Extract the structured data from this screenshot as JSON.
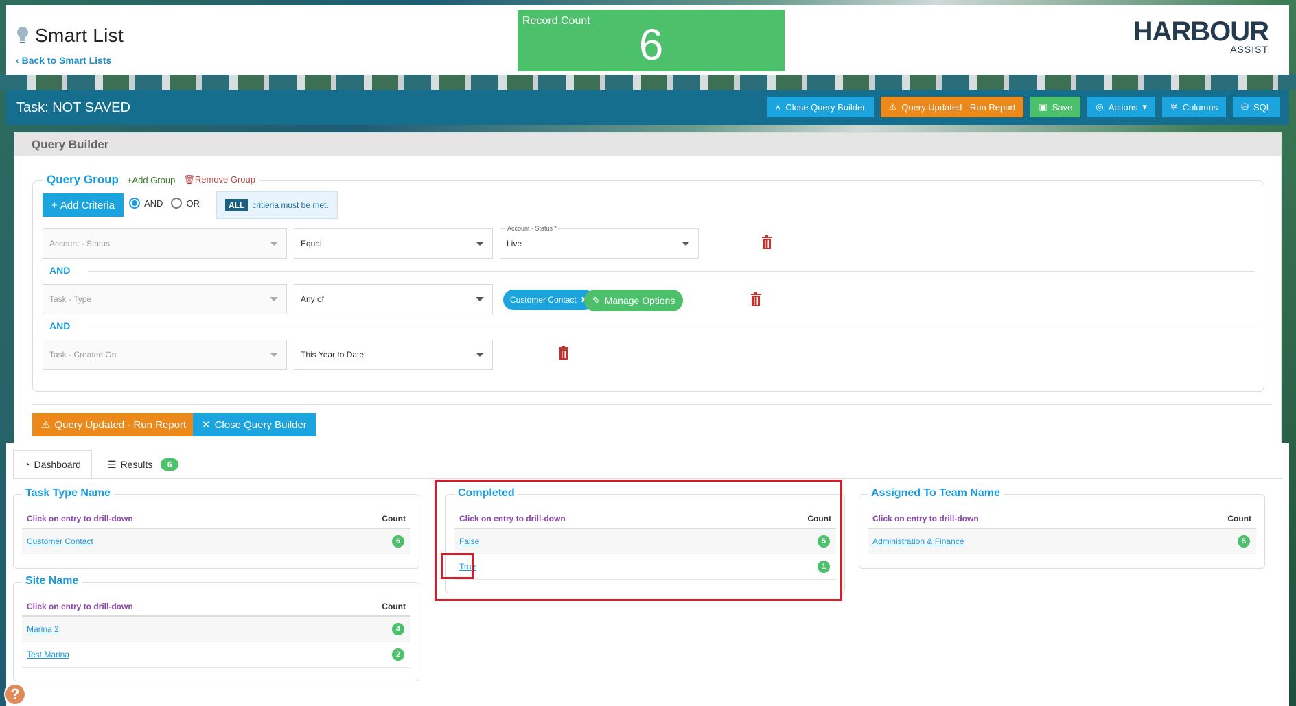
{
  "header": {
    "title": "Smart List",
    "back_link": "Back to Smart Lists",
    "record_count_label": "Record Count",
    "record_count_value": "6",
    "logo_main": "HARBOUR",
    "logo_sub": "ASSIST"
  },
  "taskbar": {
    "title": "Task: NOT SAVED",
    "buttons": {
      "close_query_builder": "Close Query Builder",
      "run_report": "Query Updated - Run Report",
      "save": "Save",
      "actions": "Actions",
      "columns": "Columns",
      "sql": "SQL"
    }
  },
  "query_builder": {
    "heading": "Query Builder",
    "group_title": "Query Group",
    "add_group": "Add Group",
    "remove_group": "Remove Group",
    "add_criteria": "Add Criteria",
    "logic_and": "AND",
    "logic_or": "OR",
    "selected_logic": "AND",
    "all_pill": "ALL",
    "all_text": "critieria must be met.",
    "connector": "AND",
    "criteria": [
      {
        "field": "Account - Status",
        "operator": "Equal",
        "value_label": "Account - Status *",
        "value": "Live"
      },
      {
        "field": "Task - Type",
        "operator": "Any of",
        "chip": "Customer Contact",
        "manage": "Manage Options"
      },
      {
        "field": "Task - Created On",
        "operator": "This Year to Date"
      }
    ],
    "bottom_run_report": "Query Updated - Run Report",
    "bottom_close": "Close Query Builder"
  },
  "tabs": {
    "dashboard": "Dashboard",
    "results": "Results",
    "results_count": "6"
  },
  "widgets": {
    "drill_label": "Click on entry to drill-down",
    "count_label": "Count",
    "task_type": {
      "title": "Task Type Name",
      "rows": [
        {
          "label": "Customer Contact",
          "count": "6"
        }
      ]
    },
    "site_name": {
      "title": "Site Name",
      "rows": [
        {
          "label": "Marina 2",
          "count": "4"
        },
        {
          "label": "Test Marina",
          "count": "2"
        }
      ]
    },
    "completed": {
      "title": "Completed",
      "rows": [
        {
          "label": "False",
          "count": "5"
        },
        {
          "label": "True",
          "count": "1"
        }
      ]
    },
    "assigned_team": {
      "title": "Assigned To Team Name",
      "rows": [
        {
          "label": "Administration & Finance",
          "count": "5"
        }
      ]
    }
  },
  "help": "?",
  "colors": {
    "accent_blue": "#1ba4de",
    "bar_teal": "#156e8e",
    "green": "#4cc06b",
    "orange": "#eb8a1b",
    "highlight_red": "#d21f2a"
  }
}
